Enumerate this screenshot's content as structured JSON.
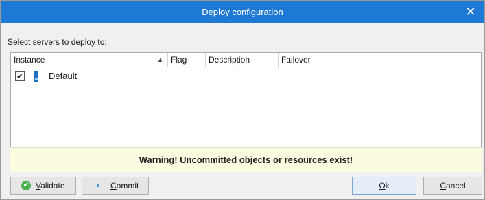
{
  "window": {
    "title": "Deploy configuration",
    "close_glyph": "✕"
  },
  "prompt": "Select servers to deploy to:",
  "grid": {
    "columns": [
      "Instance",
      "Flag",
      "Description",
      "Failover"
    ],
    "sort": {
      "column": "Instance",
      "direction": "ascending"
    },
    "rows": [
      {
        "checked": true,
        "icon": "server-icon",
        "instance": "Default",
        "flag": "",
        "description": "",
        "failover": ""
      }
    ]
  },
  "warning": "Warning! Uncommitted objects or resources exist!",
  "buttons": {
    "validate": {
      "access_key": "V",
      "rest": "alidate",
      "icon": "check-circle-icon"
    },
    "commit": {
      "access_key": "C",
      "rest": "ommit",
      "icon": "dot-icon"
    },
    "ok": {
      "access_key": "O",
      "rest": "k"
    },
    "cancel": {
      "access_key": "C",
      "rest": "ancel"
    }
  },
  "colors": {
    "titlebar": "#1d79d3",
    "warning_bg": "#fbfbdf",
    "validate_icon": "#4caf50"
  }
}
